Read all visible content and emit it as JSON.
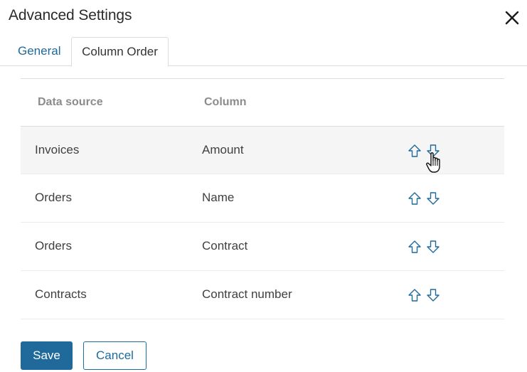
{
  "dialog": {
    "title": "Advanced Settings"
  },
  "tabs": [
    {
      "label": "General",
      "active": false
    },
    {
      "label": "Column Order",
      "active": true
    }
  ],
  "table": {
    "headers": {
      "source": "Data source",
      "column": "Column"
    },
    "rows": [
      {
        "source": "Invoices",
        "column": "Amount",
        "hovered": true
      },
      {
        "source": "Orders",
        "column": "Name",
        "hovered": false
      },
      {
        "source": "Orders",
        "column": "Contract",
        "hovered": false
      },
      {
        "source": "Contracts",
        "column": "Contract number",
        "hovered": false
      }
    ]
  },
  "icons": {
    "close": "close-icon",
    "move_up": "arrow-up-icon",
    "move_down": "arrow-down-icon",
    "cursor": "hand-pointer-icon"
  },
  "buttons": {
    "save": "Save",
    "cancel": "Cancel"
  },
  "colors": {
    "accent": "#1f6a9a",
    "hover_row": "#f5f5f5",
    "arrow": "#1f6a9a"
  }
}
